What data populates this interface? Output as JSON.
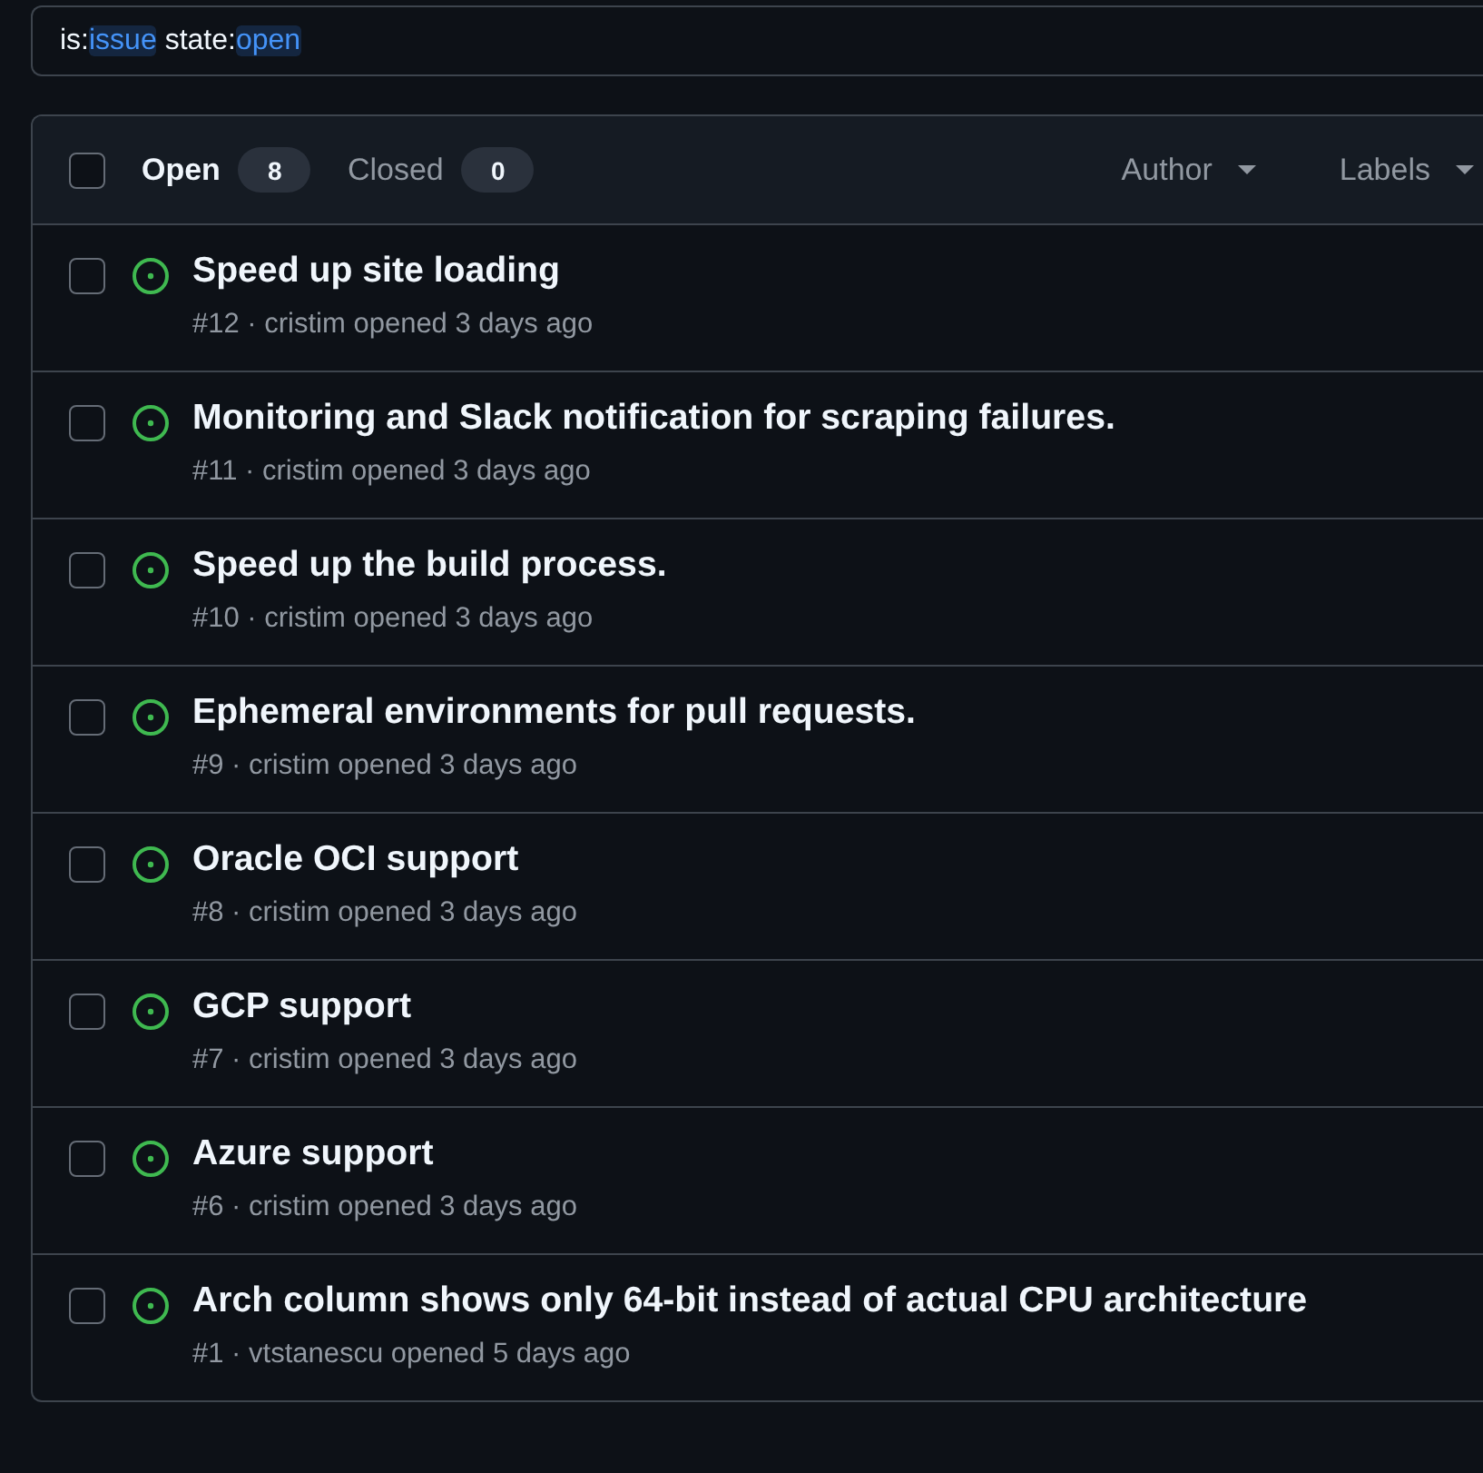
{
  "search": {
    "qualifiers": [
      {
        "key": "is:",
        "value": "issue"
      },
      {
        "key": "state:",
        "value": "open"
      }
    ]
  },
  "header": {
    "select_all": {
      "checked": false
    },
    "states": [
      {
        "label": "Open",
        "count": "8",
        "selected": true
      },
      {
        "label": "Closed",
        "count": "0",
        "selected": false
      }
    ],
    "filters": [
      {
        "label": "Author"
      },
      {
        "label": "Labels"
      }
    ]
  },
  "issues": [
    {
      "title": "Speed up site loading",
      "meta": "#12 · cristim opened 3 days ago",
      "kind": "open",
      "checked": false
    },
    {
      "title": "Monitoring and Slack notification for scraping failures.",
      "meta": "#11 · cristim opened 3 days ago",
      "kind": "open",
      "checked": false
    },
    {
      "title": "Speed up the build process.",
      "meta": "#10 · cristim opened 3 days ago",
      "kind": "open",
      "checked": false
    },
    {
      "title": "Ephemeral environments for pull requests.",
      "meta": "#9 · cristim opened 3 days ago",
      "kind": "open",
      "checked": false
    },
    {
      "title": "Oracle OCI support",
      "meta": "#8 · cristim opened 3 days ago",
      "kind": "open",
      "checked": false
    },
    {
      "title": "GCP support",
      "meta": "#7 · cristim opened 3 days ago",
      "kind": "open",
      "checked": false
    },
    {
      "title": "Azure support",
      "meta": "#6 · cristim opened 3 days ago",
      "kind": "open",
      "checked": false
    },
    {
      "title": "Arch column shows only 64-bit instead of actual CPU architecture",
      "meta": "#1 · vtstanescu opened 5 days ago",
      "kind": "open",
      "checked": false
    }
  ]
}
